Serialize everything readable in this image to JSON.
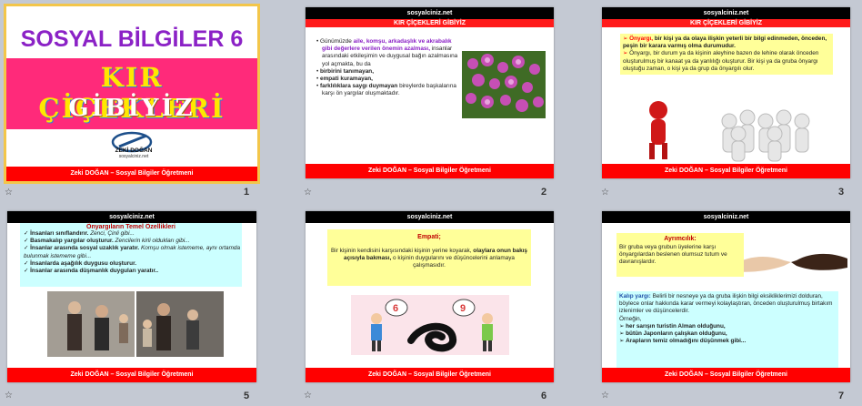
{
  "site": "sosyalciniz.net",
  "footer": "Zeki DOĞAN – Sosyal Bilgiler Öğretmeni",
  "slides": [
    {
      "number": "1",
      "title": "SOSYAL BİLGİLER 6",
      "subtitle1": "KIR ÇİÇEKLERİ",
      "subtitle2": "GİBİYİZ",
      "logo_name": "ZEKİ DOĞAN",
      "logo_site": "sosyalciniz.net"
    },
    {
      "number": "2",
      "header": "KIR ÇİÇEKLERİ GİBİYİZ",
      "bullet1_plain_a": "Günümüzde ",
      "bullet1_highlight": "aile, komşu, arkadaşlık ve akrabalık gibi değerlere verilen önemin azalması,",
      "bullet1_plain_b": " insanlar arasındaki etkileşimin ve duygusal bağın azalmasına yol açmakta, bu da",
      "bullet2": "birbirini tanımayan,",
      "bullet3": "empati kuramayan,",
      "bullet4_bold": "farklılıklara saygı duymayan",
      "bullet4_rest": "bireylerde başkalarına karşı ön yargılar oluşmaktadır."
    },
    {
      "number": "3",
      "header": "KIR ÇİÇEKLERİ GİBİYİZ",
      "item1_red": "Önyargı,",
      "item1_bold": " bir kişi ya da olaya ilişkin yeterli bir bilgi edinmeden, önceden, peşin bir karara varmış olma durumudur.",
      "item2": "Önyargı, bir durum ya da kişinin aleyhine bazen de lehine olarak önceden oluşturulmuş bir kanaat ya da yanlılığı oluşturur. Bir kişi ya da gruba önyargı oluştuğu zaman, o kişi ya da grup da önyargılı olur."
    },
    {
      "number": "5",
      "header": "Önyargıların Temel Özellikleri",
      "items": [
        {
          "bold": "İnsanları sınıflandırır.",
          "rest": " Zenci, Çinli gibi..."
        },
        {
          "bold": "Basmakalıp yargılar oluşturur.",
          "rest": " Zencilerin kirli oldukları gibi..."
        },
        {
          "bold": "İnsanlar arasında sosyal uzaklık yaratır.",
          "rest": " Komşu olmak istememe, aynı ortamda bulunmak istememe gibi..."
        },
        {
          "bold": "İnsanlarda aşağılık duygusu oluşturur.",
          "rest": ""
        },
        {
          "bold": "İnsanlar arasında düşmanlık duyguları yaratır..",
          "rest": ""
        }
      ]
    },
    {
      "number": "6",
      "label": "Empati;",
      "text_a": "Bir kişinin kendisini karşısındaki kişinin yerine koyarak, ",
      "text_b": "olaylara onun bakış açısıyla bakması,",
      "text_c": " o kişinin duygularını ve düşüncelerini anlamaya çalışmasıdır.",
      "bubble_left": "6",
      "bubble_right": "9"
    },
    {
      "number": "7",
      "label": "Ayrımcılık:",
      "text1": "Bir gruba veya grubun üyelerine karşı önyargılardan beslenen olumsuz tutum ve davranışlardır.",
      "label2": "Kalıp yargı:",
      "text2": " Belirli bir nesneye ya da gruba ilişkin bilgi eksikliklerimizi dolduran, böylece onlar hakkında karar vermeyi kolaylaştıran, önceden oluşturulmuş birtakım izlenimler ve düşüncelerdir.",
      "example": "Örneğin,",
      "items": [
        "her sarışın turistin Alman olduğunu,",
        "bütün Japonların çalışkan olduğunu,",
        "Arapların temiz olmadığını düşünmek gibi..."
      ]
    }
  ],
  "colors": {
    "title_purple": "#8b22c6",
    "banner_pink": "#ff2a7a",
    "footer_red": "#ff0000",
    "selection_yellow": "#f3c64a",
    "box_yellow": "#ffff99",
    "box_cyan": "#ccffff"
  }
}
